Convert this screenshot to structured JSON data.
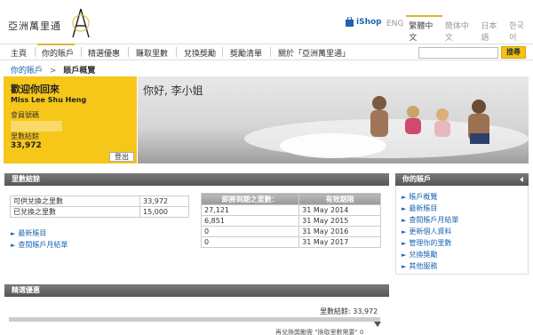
{
  "header": {
    "logo_text": "亞洲萬里通",
    "ishop_label": "iShop",
    "languages": [
      "ENG",
      "繁體中文",
      "簡体中文",
      "日本語",
      "한국어"
    ]
  },
  "nav": {
    "items": [
      "主頁",
      "你的賬戶",
      "精選優惠",
      "賺取里數",
      "兌換獎勵",
      "獎勵清單",
      "關於「亞洲萬里通」"
    ],
    "active_index": 1,
    "search_placeholder": "",
    "search_button": "搜尋"
  },
  "breadcrumb": {
    "parent": "你的賬戶",
    "separator": ">",
    "current": "賬戶概覽"
  },
  "hero": {
    "welcome": "歡迎你回來",
    "name": "Miss Lee Shu Heng",
    "member_label": "會員號碼",
    "miles_label": "里數結餘",
    "miles_value": "33,972",
    "logout_label": "登出",
    "greeting": "你好, 李小姐"
  },
  "balance": {
    "title": "里數結餘",
    "rows": [
      {
        "label": "可供兌換之里數",
        "value": "33,972"
      },
      {
        "label": "已兌換之里數",
        "value": "15,000"
      }
    ],
    "links": [
      "最新賬目",
      "查閱賬戶月結單"
    ]
  },
  "expiry": {
    "headers": [
      "即將到期之里數：",
      "有效期限"
    ],
    "rows": [
      {
        "miles": "27,121",
        "date": "31 May 2014"
      },
      {
        "miles": "6,851",
        "date": "31 May 2015"
      },
      {
        "miles": "0",
        "date": "31 May 2016"
      },
      {
        "miles": "0",
        "date": "31 May 2017"
      }
    ]
  },
  "sidebar": {
    "title": "你的賬戶",
    "items": [
      "賬戶概覽",
      "最新賬目",
      "查閱賬戶月結單",
      "更新個人資料",
      "管理你的里數",
      "兌換獎勵",
      "其他服務"
    ]
  },
  "offers": {
    "title": "精選優惠",
    "miles_label": "里數結餘: 33,972",
    "progress_text": "再兌換獎勵需 \"換取里數需要\" 0"
  },
  "colors": {
    "brand_yellow": "#f6c619",
    "link_blue": "#1b65b0",
    "header_gray": "#666666"
  }
}
